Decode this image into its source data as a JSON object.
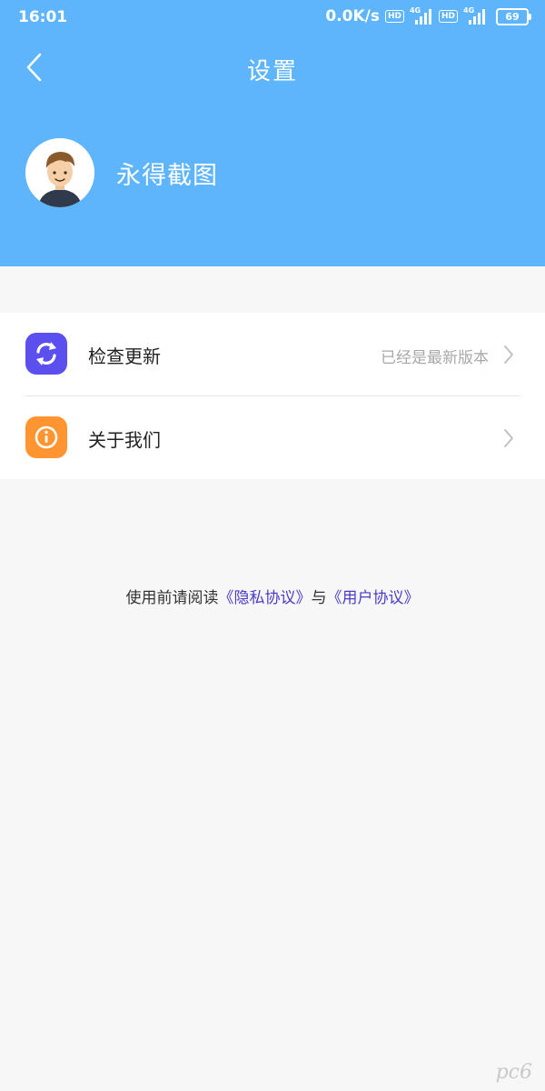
{
  "status_bar": {
    "time": "16:01",
    "net_speed": "0.0K/s",
    "hd_label": "HD",
    "network_gen": "4G",
    "battery": "69"
  },
  "header": {
    "title": "设置",
    "user_name": "永得截图",
    "background_color": "#5fb5fb"
  },
  "menu": {
    "items": [
      {
        "label": "检查更新",
        "value": "已经是最新版本",
        "icon": "refresh-icon",
        "icon_color": "#5b4ff0"
      },
      {
        "label": "关于我们",
        "value": "",
        "icon": "info-icon",
        "icon_color": "#ff9530"
      }
    ]
  },
  "agreement": {
    "prefix": "使用前请阅读",
    "privacy_link": "《隐私协议》",
    "conjunction": "与",
    "user_link": "《用户协议》",
    "link_color": "#4a3cc7"
  },
  "watermark": "pc6"
}
